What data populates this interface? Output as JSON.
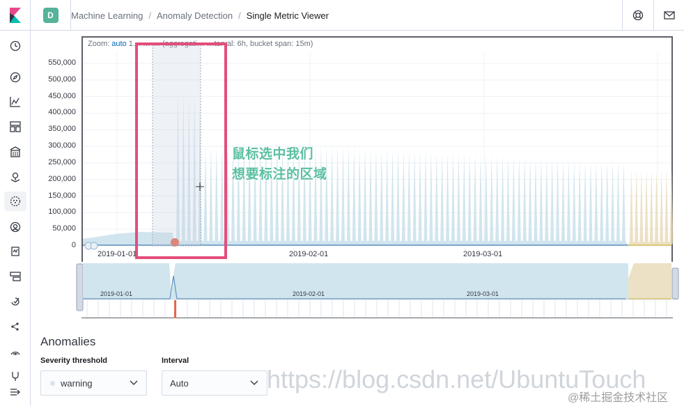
{
  "header": {
    "space_initial": "D",
    "breadcrumbs": [
      "Machine Learning",
      "Anomaly Detection",
      "Single Metric Viewer"
    ]
  },
  "icons": {
    "logo": "kibana-logo",
    "help": "help-lifebuoy-icon",
    "mail": "mail-icon",
    "nav": [
      "clock-icon",
      "compass-icon",
      "visualize-icon",
      "dashboard-icon",
      "canvas-icon",
      "maps-icon",
      "ml-icon",
      "infra-icon",
      "apm-icon",
      "uptime-icon",
      "siem-icon",
      "graph-icon",
      "monitoring-icon",
      "management-icon",
      "collapse-icon"
    ]
  },
  "chart": {
    "zoom_label": "Zoom: ",
    "zoom_value": "auto",
    "zoom_rest": " 1… … … (aggregati… …terval: 6h, bucket span: 15m)",
    "y_ticks": [
      "550,000",
      "500,000",
      "450,000",
      "400,000",
      "350,000",
      "300,000",
      "250,000",
      "200,000",
      "150,000",
      "100,000",
      "50,000",
      "0"
    ],
    "x_ticks": [
      "2019-01-01",
      "2019-02-01",
      "2019-03-01"
    ],
    "context_x_ticks": [
      "2019-01-01",
      "2019-02-01",
      "2019-03-01"
    ],
    "annotation_lines": [
      "鼠标选中我们",
      "想要标注的区域"
    ]
  },
  "chart_data": {
    "type": "area",
    "title": "",
    "xlabel": "",
    "ylabel": "",
    "ylim": [
      0,
      550000
    ],
    "x": [
      "2019-01-01",
      "2019-02-01",
      "2019-03-01"
    ],
    "series": [
      {
        "values": [
          37000,
          460000,
          280000
        ]
      }
    ],
    "anomaly_markers": [
      {
        "x": "2019-01-10",
        "severity": "critical",
        "color": "#e7664c"
      }
    ],
    "colors": {
      "model_bounds": "#d1e5ee",
      "actual": "#6092c0",
      "forecast": "#e6d7b2",
      "selection": "#e34e7b"
    },
    "grid": true
  },
  "anomalies": {
    "title": "Anomalies",
    "severity_label": "Severity threshold",
    "severity_value": "warning",
    "interval_label": "Interval",
    "interval_value": "Auto"
  },
  "watermark": "https://blog.csdn.net/UbuntuTouch",
  "watermark2": "@稀土掘金技术社区"
}
